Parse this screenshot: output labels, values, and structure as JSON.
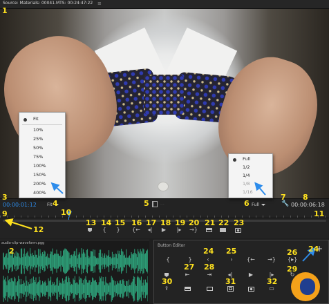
{
  "panel": {
    "title": "Source: Materials: 00041.MTS: 00:24:47:22",
    "menu_icon": "≡"
  },
  "zoom_menu": {
    "options": [
      "Fit",
      "10%",
      "25%",
      "50%",
      "75%",
      "100%",
      "150%",
      "200%",
      "400%"
    ],
    "selected": "Fit"
  },
  "resolution_menu": {
    "options": [
      "Full",
      "1/2",
      "1/4",
      "1/8",
      "1/16"
    ],
    "disabled": [
      "1/8",
      "1/16"
    ],
    "selected": "Full"
  },
  "controls": {
    "timecode_current": "00:00:01:12",
    "zoom_value": "Fit",
    "resolution_value": "Full",
    "timecode_duration": "00:00:06:18",
    "settings_icon": "wrench-icon",
    "drag_video_icon": "filmstrip-icon",
    "drag_audio_icon": "waveform-icon"
  },
  "transport_icons": {
    "add_marker": "marker-icon",
    "mark_in": "{",
    "mark_out": "}",
    "go_to_in": "{←",
    "step_back": "◂|",
    "play": "▶",
    "step_forward": "|▸",
    "go_to_out": "→}",
    "insert": "insert-icon",
    "overwrite": "overwrite-icon",
    "export_frame": "camera-icon"
  },
  "lower_left": {
    "tab_label": "audio-clip-waveform.pgg"
  },
  "button_editor": {
    "title": "Button Editor",
    "add_icon": "+"
  },
  "callouts": [
    "1",
    "2",
    "3",
    "4",
    "5",
    "6",
    "7",
    "8",
    "9",
    "10",
    "11",
    "12",
    "13",
    "14",
    "15",
    "16",
    "17",
    "18",
    "19",
    "20",
    "21",
    "22",
    "23",
    "24",
    "25",
    "26",
    "27",
    "28",
    "29",
    "30",
    "31",
    "32"
  ],
  "colors": {
    "accent_blue": "#2d8ceb",
    "callout_yellow": "#ffe21f",
    "panel_bg": "#232323",
    "waveform_green": "#2fa87f"
  }
}
